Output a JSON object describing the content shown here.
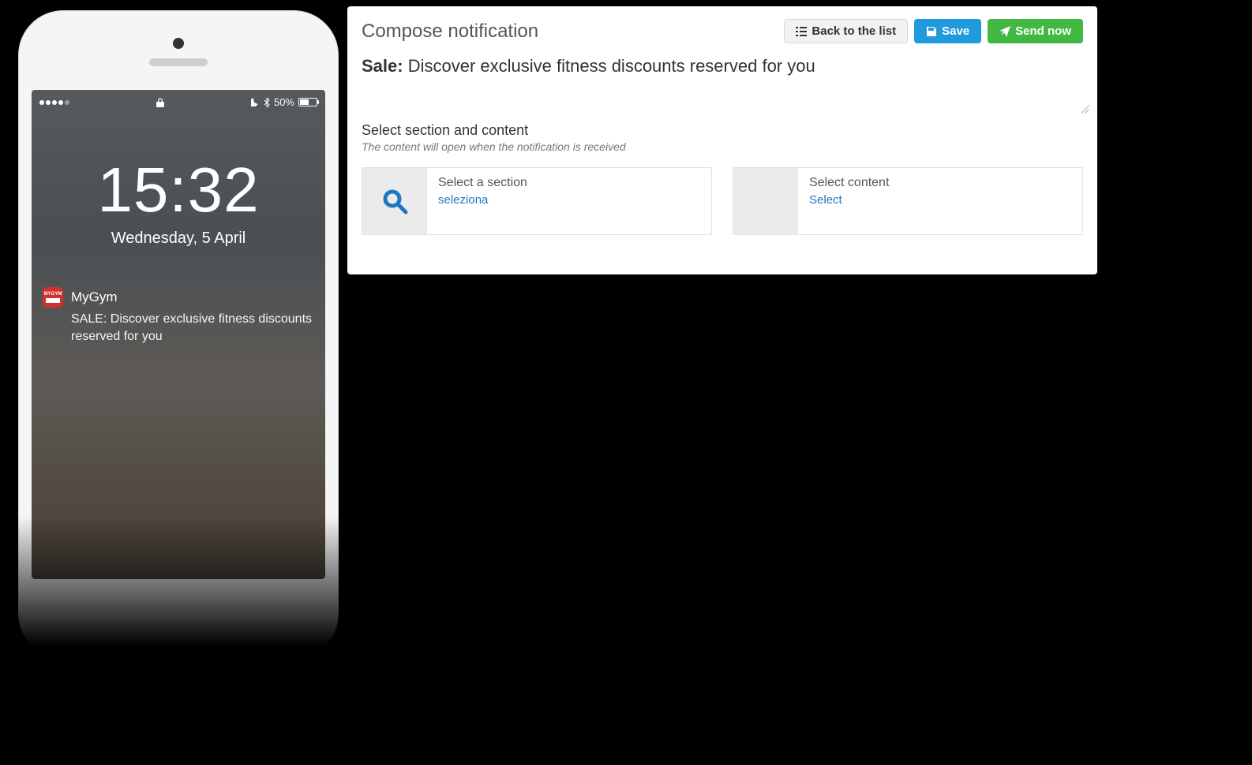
{
  "phone": {
    "status": {
      "battery_pct": "50%",
      "lock_icon": "lock-icon",
      "moon_icon": "moon-icon",
      "bluetooth_icon": "bluetooth-icon"
    },
    "time": "15:32",
    "date": "Wednesday, 5 April",
    "notification": {
      "app_badge_text": "MYGYM",
      "app_name": "MyGym",
      "body": "SALE: Discover exclusive fitness discounts reserved for you"
    }
  },
  "panel": {
    "title": "Compose notification",
    "buttons": {
      "back": "Back to the list",
      "save": "Save",
      "send": "Send now"
    },
    "compose": {
      "prefix": "Sale:",
      "text": "Discover exclusive fitness discounts reserved for you"
    },
    "section": {
      "label": "Select section and content",
      "hint": "The content will open when the notification is received",
      "left": {
        "title": "Select a section",
        "action": "seleziona"
      },
      "right": {
        "title": "Select content",
        "action": "Select"
      }
    }
  }
}
